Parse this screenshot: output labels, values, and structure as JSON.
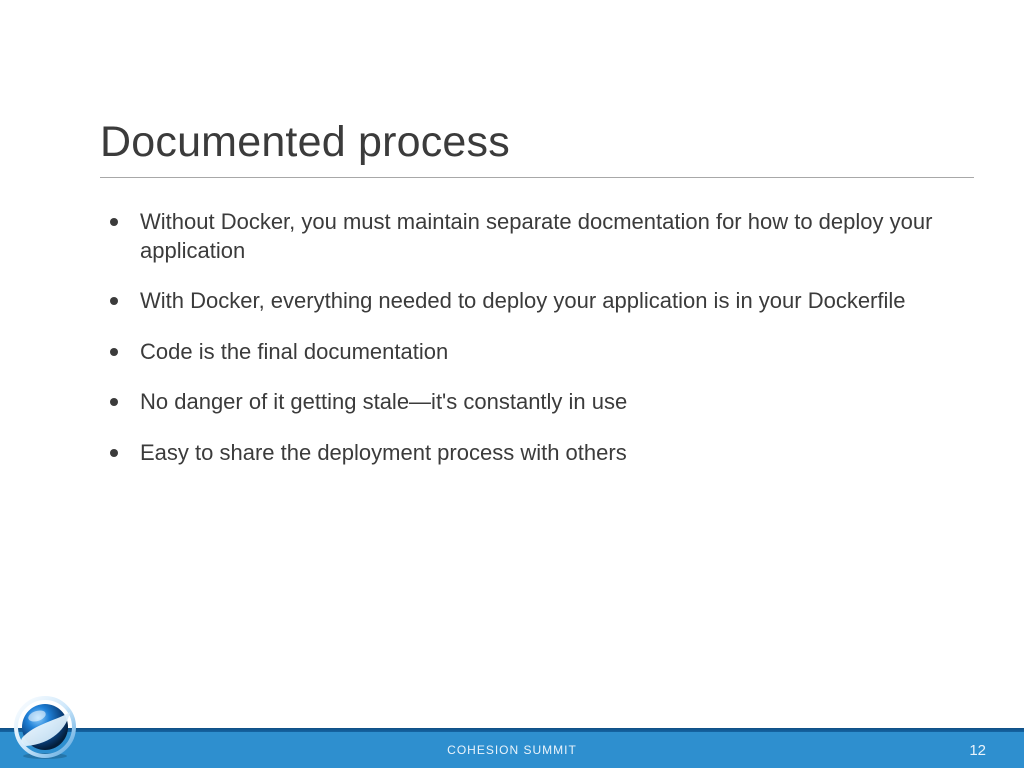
{
  "slide": {
    "title": "Documented process",
    "bullets": [
      "Without Docker, you must maintain separate docmentation for how to deploy your application",
      "With Docker, everything needed to deploy your application is in your Dockerfile",
      "Code is the final documentation",
      "No danger of it getting stale—it's constantly in use",
      "Easy to share the deployment process with others"
    ]
  },
  "footer": {
    "label": "COHESION SUMMIT",
    "page": "12"
  }
}
